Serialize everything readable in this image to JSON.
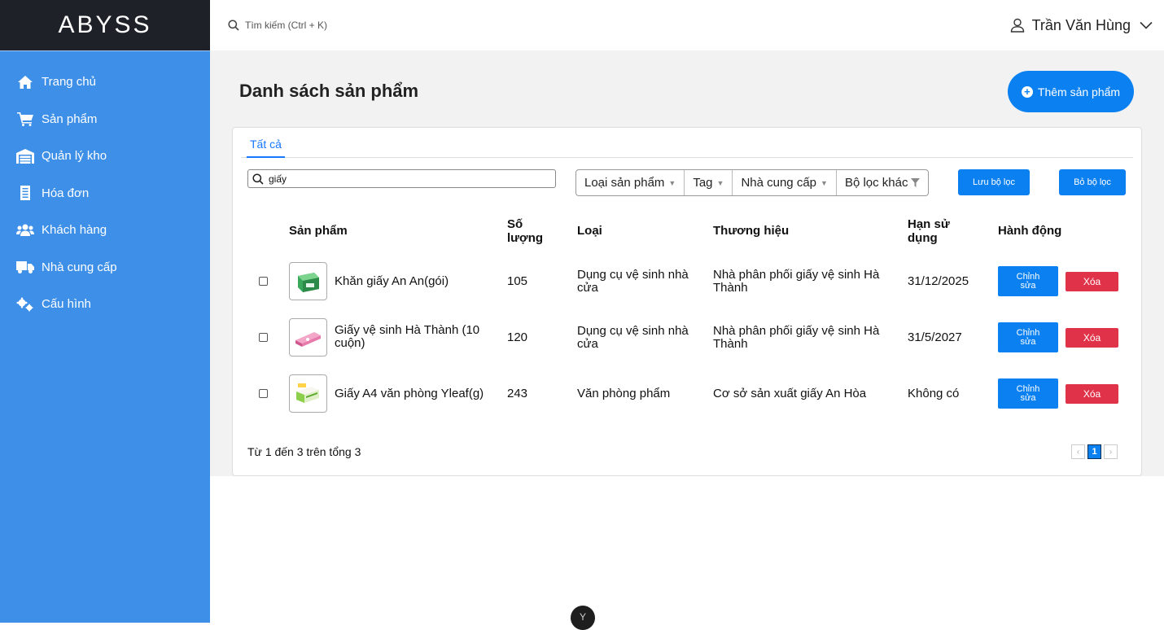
{
  "brand": "ABYSS",
  "sidebar": {
    "items": [
      {
        "label": "Trang chủ",
        "icon": "home-icon"
      },
      {
        "label": "Sản phẩm",
        "icon": "cart-icon"
      },
      {
        "label": "Quản lý kho",
        "icon": "warehouse-icon"
      },
      {
        "label": "Hóa đơn",
        "icon": "invoice-icon"
      },
      {
        "label": "Khách hàng",
        "icon": "users-icon"
      },
      {
        "label": "Nhà cung cấp",
        "icon": "truck-icon"
      },
      {
        "label": "Cấu hình",
        "icon": "cogs-icon"
      }
    ]
  },
  "topbar": {
    "search_placeholder": "Tìm kiếm (Ctrl + K)",
    "user_name": "Trần Văn Hùng"
  },
  "page": {
    "title": "Danh sách sản phẩm",
    "add_button": "Thêm sản phẩm"
  },
  "tabs": {
    "all": "Tất cả"
  },
  "search": {
    "value": "giấy"
  },
  "filters": {
    "product_type": "Loại sản phẩm",
    "tag": "Tag",
    "supplier": "Nhà cung cấp",
    "other": "Bộ lọc khác",
    "save": "Lưu bộ lọc",
    "clear": "Bỏ bộ lọc"
  },
  "table": {
    "headers": {
      "product": "Sản phẩm",
      "qty_line1": "Số",
      "qty_line2": "lượng",
      "type": "Loại",
      "brand": "Thương hiệu",
      "exp_line1": "Hạn sử",
      "exp_line2": "dụng",
      "actions": "Hành động"
    },
    "rows": [
      {
        "name": "Khăn giấy An An(gói)",
        "qty": "105",
        "type": "Dụng cụ vệ sinh nhà cửa",
        "brand": "Nhà phân phối giấy vệ sinh Hà Thành",
        "expiry": "31/12/2025"
      },
      {
        "name": "Giấy vệ sinh Hà Thành (10 cuộn)",
        "qty": "120",
        "type": "Dụng cụ vệ sinh nhà cửa",
        "brand": "Nhà phân phối giấy vệ sinh Hà Thành",
        "expiry": "31/5/2027"
      },
      {
        "name": "Giấy A4 văn phòng Yleaf(g)",
        "qty": "243",
        "type": "Văn phòng phẩm",
        "brand": "Cơ sở sản xuất giấy An Hòa",
        "expiry": "Không có"
      }
    ],
    "edit_label": "Chỉnh sửa",
    "delete_label": "Xóa"
  },
  "pagination": {
    "info": "Từ 1 đến 3 trên tổng 3",
    "current_page": "1",
    "prev": "‹",
    "next": "›"
  },
  "colors": {
    "sidebar": "#3d8fe8",
    "brand_bg": "#1e2128",
    "primary": "#0b80f0",
    "danger": "#e0334a"
  }
}
